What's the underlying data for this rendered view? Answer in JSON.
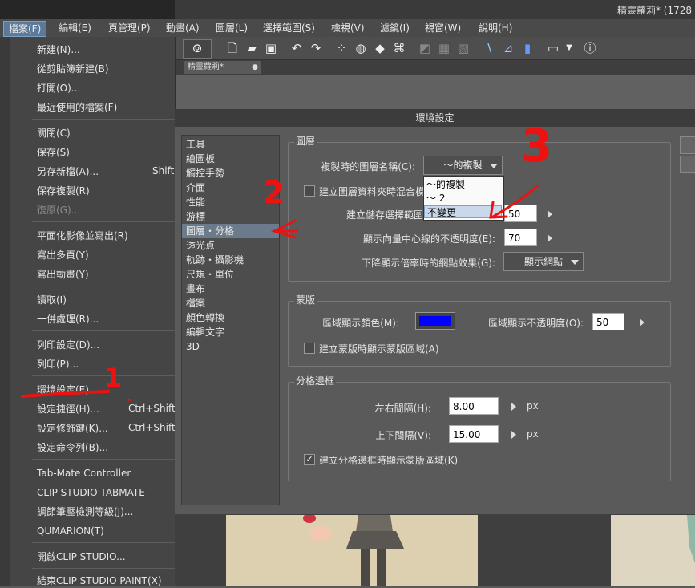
{
  "window": {
    "title": "精靈蘿莉* (1728"
  },
  "menubar": [
    "檔案(F)",
    "編輯(E)",
    "頁管理(P)",
    "動畫(A)",
    "圖層(L)",
    "選擇範圍(S)",
    "檢視(V)",
    "濾鏡(I)",
    "視窗(W)",
    "說明(H)"
  ],
  "document_tab": {
    "label": "精靈蘿莉*"
  },
  "file_menu": {
    "items": [
      "新建(N)...",
      "從剪貼簿新建(B)",
      "打開(O)...",
      "最近使用的檔案(F)",
      "關閉(C)",
      "保存(S)",
      "另存新檔(A)...",
      "保存複製(R)",
      "復原(G)...",
      "平面化影像並寫出(R)",
      "寫出多頁(Y)",
      "寫出動畫(Y)",
      "讀取(I)",
      "一併處理(R)...",
      "列印設定(D)...",
      "列印(P)...",
      "環境設定(E)...",
      "設定捷徑(H)...",
      "設定修飾鍵(K)...",
      "設定命令列(B)...",
      "Tab-Mate Controller",
      "CLIP STUDIO TABMATE",
      "調節筆壓檢測等級(J)...",
      "QUMARION(T)",
      "開啟CLIP STUDIO...",
      "結束CLIP STUDIO PAINT(X)"
    ],
    "shortcuts": {
      "save_as": "Shift",
      "shortcut_settings": "Ctrl+Shift-",
      "modifier_settings": "Ctrl+Shift-"
    }
  },
  "dialog": {
    "title": "環境設定",
    "categories": [
      "工具",
      "繪圖板",
      "觸控手勢",
      "介面",
      "性能",
      "游標",
      "圖層・分格",
      "透光点",
      "軌跡・攝影機",
      "尺規・單位",
      "畫布",
      "檔案",
      "顏色轉換",
      "編輯文字",
      "3D"
    ],
    "selected_category": "圖層・分格",
    "layer": {
      "group_label": "圖層",
      "copy_name_label": "複製時的圖層名稱(C):",
      "copy_name_value": "～的複製",
      "copy_name_options": [
        "～的複製",
        "～ 2",
        "不變更"
      ],
      "highlighted_option": "不變更",
      "blend_checkbox_label": "建立圖層資料夾時混合模",
      "selection_opacity_label": "建立儲存選擇範圍",
      "selection_opacity_value": "50",
      "vector_center_label": "顯示向量中心線的不透明度(E):",
      "vector_center_value": "70",
      "zoom_effect_label": "下降顯示倍率時的網點效果(G):",
      "zoom_effect_value": "顯示網點"
    },
    "mask": {
      "group_label": "蒙版",
      "area_color_label": "區域顯示顏色(M):",
      "area_color": "#0000ff",
      "area_opacity_label": "區域顯示不透明度(O):",
      "area_opacity_value": "50",
      "show_mask_label": "建立蒙版時顯示蒙版區域(A)",
      "show_mask_checked": false
    },
    "frame": {
      "group_label": "分格邊框",
      "horizontal_label": "左右間隔(H):",
      "horizontal_value": "8.00",
      "vertical_label": "上下間隔(V):",
      "vertical_value": "15.00",
      "unit": "px",
      "show_mask_label": "建立分格邊框時顯示蒙版區域(K)",
      "show_mask_checked": true
    }
  },
  "annotations": [
    "1",
    "2",
    "3"
  ]
}
